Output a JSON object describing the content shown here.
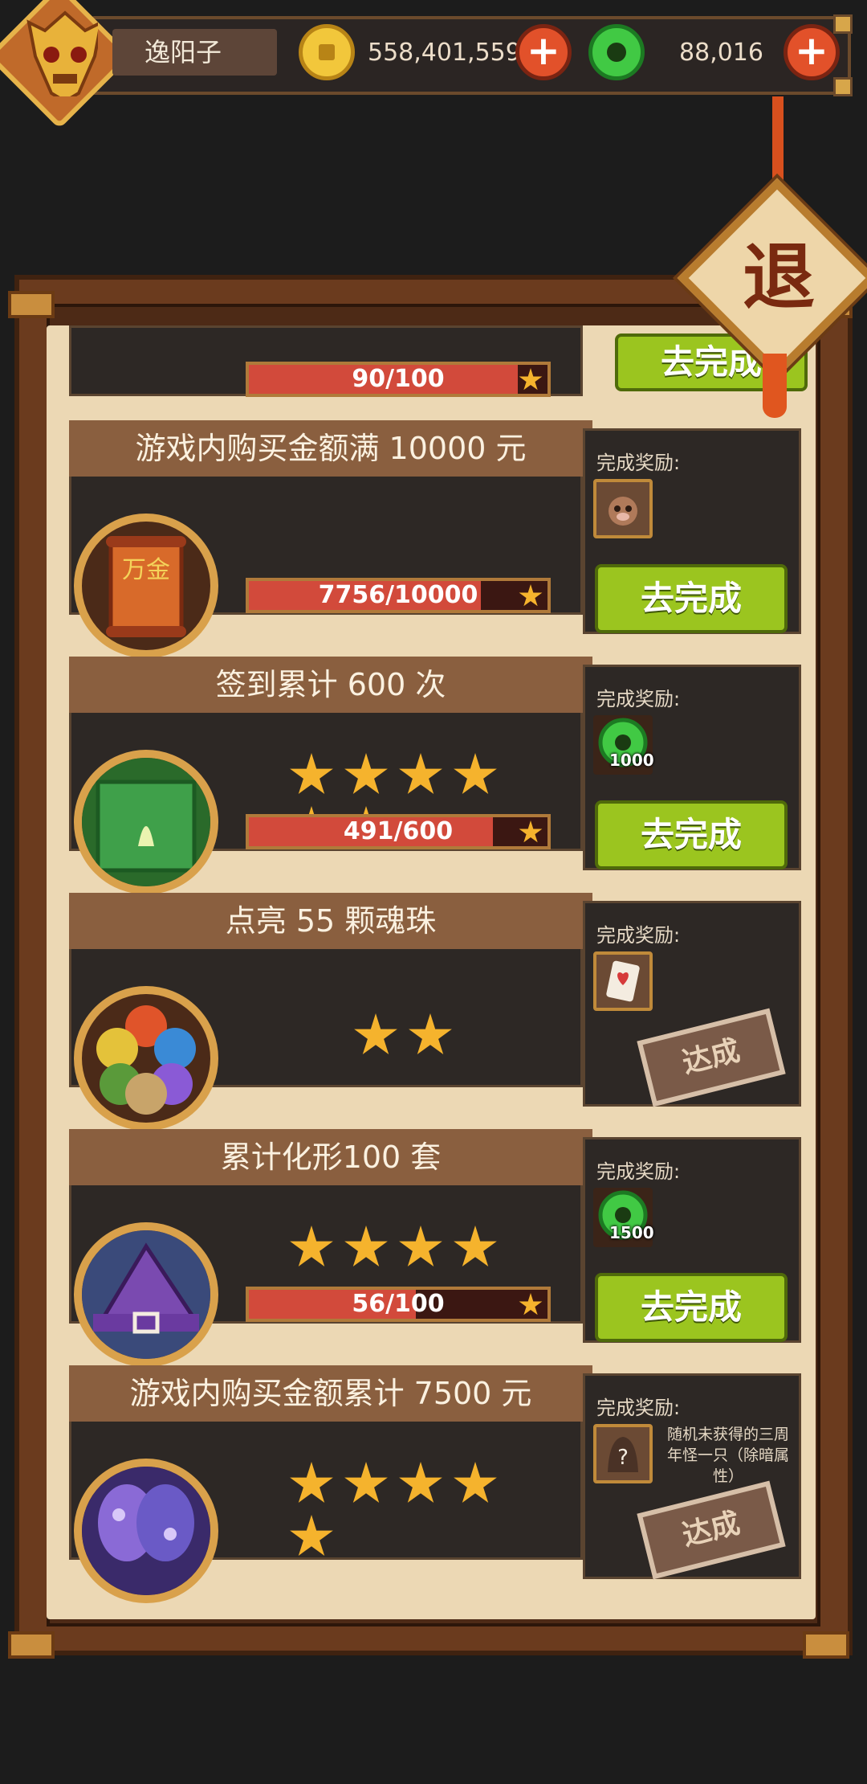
{
  "header": {
    "player_name": "逸阳子",
    "gold": "558,401,559",
    "jade": "88,016",
    "exit_label": "退"
  },
  "tasks": [
    {
      "title": "",
      "progress_text": "90/100",
      "progress": 0.9,
      "button": "去完成",
      "icon": "partial-icon"
    },
    {
      "title": "游戏内购买金额满 10000 元",
      "reward_label": "完成奖励:",
      "reward_icon": "pet-icon",
      "progress_text": "7756/10000",
      "progress": 0.7756,
      "button": "去完成",
      "icon": "scroll-wanjin-icon",
      "icon_text": "万金"
    },
    {
      "title": "签到累计 600 次",
      "reward_label": "完成奖励:",
      "reward_icon": "jade-icon",
      "reward_count": "1000",
      "stars": 6,
      "progress_text": "491/600",
      "progress": 0.818,
      "button": "去完成",
      "icon": "gate-icon"
    },
    {
      "title": "点亮 55 颗魂珠",
      "reward_label": "完成奖励:",
      "reward_icon": "card-icon",
      "stars": 2,
      "stamp": "达成",
      "icon": "soul-orbs-icon"
    },
    {
      "title": "累计化形100 套",
      "reward_label": "完成奖励:",
      "reward_icon": "jade-icon",
      "reward_count": "1500",
      "stars": 4,
      "progress_text": "56/100",
      "progress": 0.56,
      "button": "去完成",
      "icon": "wizard-hat-icon"
    },
    {
      "title": "游戏内购买金额累计 7500 元",
      "reward_label": "完成奖励:",
      "reward_icon": "mystery-monster-icon",
      "reward_desc": "随机未获得的三周年怪一只（除暗属性）",
      "stars": 5,
      "stamp": "达成",
      "icon": "butterfly-wings-icon"
    }
  ],
  "colors": {
    "button_green": "#9bc51f",
    "progress_red": "#d24a3b",
    "star_gold": "#f5b32d",
    "title_brown": "#8a5f3f"
  }
}
